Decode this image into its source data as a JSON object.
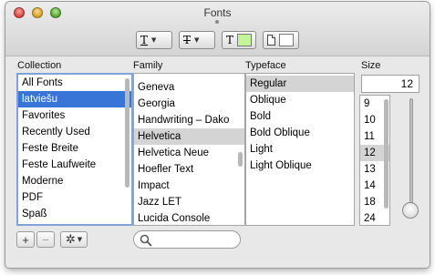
{
  "window": {
    "title": "Fonts"
  },
  "toolbar": {
    "underline_glyph": "T",
    "strikethrough_glyph": "T",
    "text_color_glyph": "T",
    "text_color": "#c5f59b",
    "doc_color": "#ffffff"
  },
  "columns": {
    "collection": "Collection",
    "family": "Family",
    "typeface": "Typeface",
    "size": "Size"
  },
  "collections": [
    "All Fonts",
    "latviešu",
    "Favorites",
    "Recently Used",
    "Feste Breite",
    "Feste Laufweite",
    "Moderne",
    "PDF",
    "Spaß"
  ],
  "collection_selected": "latviešu",
  "families": [
    "Geneva",
    "Georgia",
    "Handwriting – Dako",
    "Helvetica",
    "Helvetica Neue",
    "Hoefler Text",
    "Impact",
    "Jazz LET",
    "Lucida Console"
  ],
  "family_selected": "Helvetica",
  "typefaces": [
    "Regular",
    "Oblique",
    "Bold",
    "Bold Oblique",
    "Light",
    "Light Oblique"
  ],
  "typeface_selected": "Regular",
  "size": {
    "value": "12",
    "list": [
      "9",
      "10",
      "11",
      "12",
      "13",
      "14",
      "18",
      "24"
    ],
    "selected": "12"
  },
  "bottom": {
    "add_glyph": "+",
    "remove_glyph": "−",
    "action_glyph": "✲",
    "action_arrow": "▼"
  }
}
